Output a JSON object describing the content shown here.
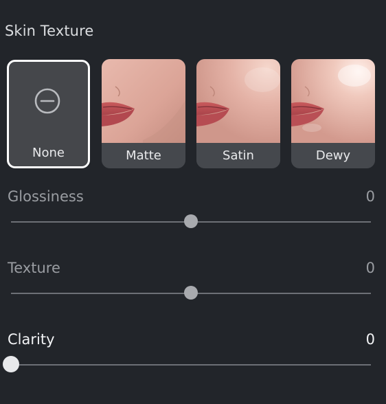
{
  "panel": {
    "title": "Skin Texture"
  },
  "presets": [
    {
      "label": "None",
      "selected": true,
      "icon": "minus-circle-icon"
    },
    {
      "label": "Matte",
      "selected": false
    },
    {
      "label": "Satin",
      "selected": false
    },
    {
      "label": "Dewy",
      "selected": false
    }
  ],
  "sliders": [
    {
      "label": "Glossiness",
      "value": "0",
      "position": 0.5,
      "active": false
    },
    {
      "label": "Texture",
      "value": "0",
      "position": 0.5,
      "active": false
    },
    {
      "label": "Clarity",
      "value": "0",
      "position": 0.0,
      "active": true
    }
  ],
  "colors": {
    "background": "#22252a",
    "selected_border": "#ffffff",
    "caption_bg": "#45484d",
    "track": "#6d7076"
  }
}
